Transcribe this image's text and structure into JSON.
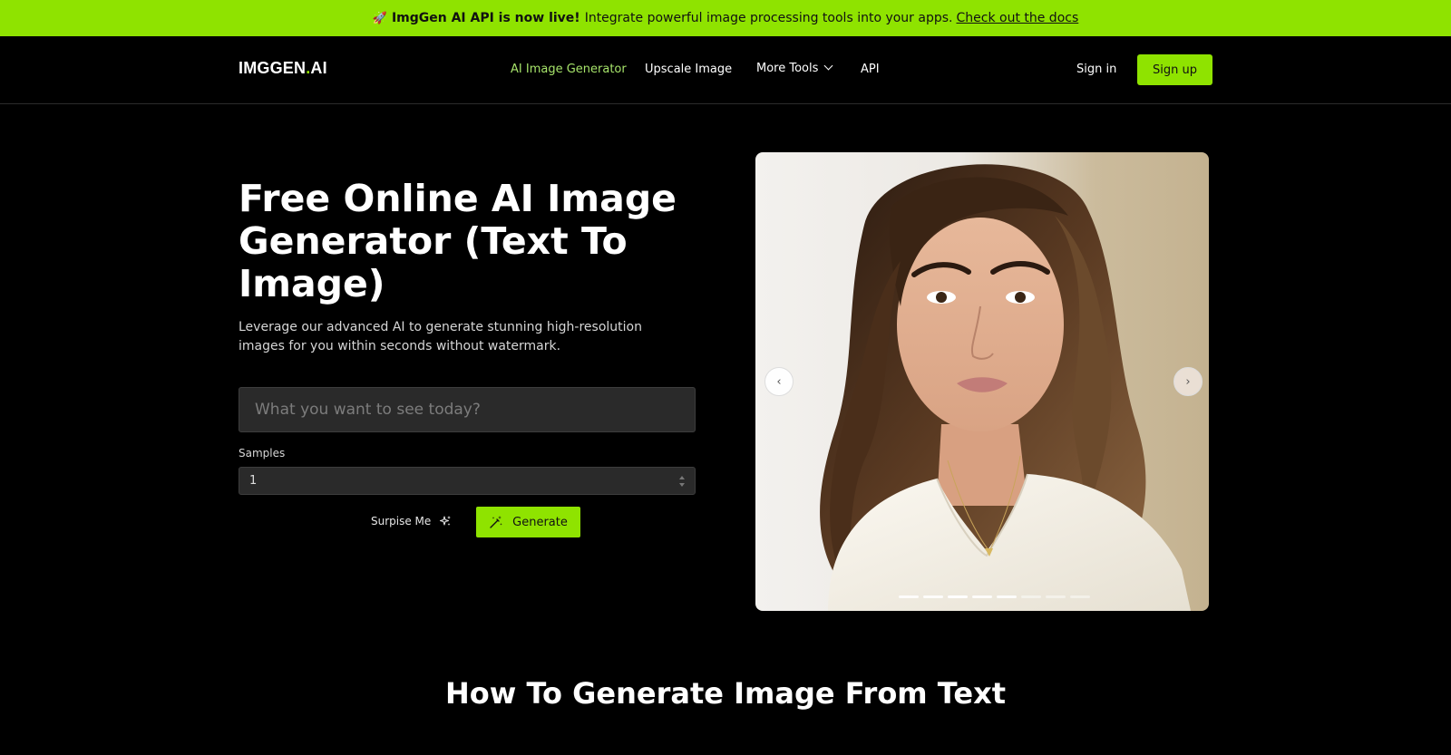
{
  "announcement": {
    "icon": "rocket-icon",
    "bold": "ImgGen AI API is now live!",
    "text": "Integrate powerful image processing tools into your apps.",
    "link": "Check out the docs"
  },
  "header": {
    "logo_main": "IMGGEN",
    "logo_dot": ".",
    "logo_suffix": "AI",
    "nav": [
      "AI Image Generator",
      "Upscale Image",
      "More Tools",
      "API"
    ],
    "signin": "Sign in",
    "signup": "Sign up"
  },
  "hero": {
    "title": "Free Online AI Image Generator (Text To Image)",
    "subtitle": "Leverage our advanced AI to generate stunning high-resolution images for you within seconds without watermark.",
    "prompt_placeholder": "What you want to see today?",
    "samples_label": "Samples",
    "samples_value": "1",
    "surprise_label": "Surpise Me",
    "generate_label": "Generate"
  },
  "carousel": {
    "prev": "‹",
    "next": "›",
    "active_index": 2,
    "slides": 8
  },
  "section": {
    "title": "How To Generate Image From Text"
  },
  "colors": {
    "accent": "#8fe300",
    "nav_active": "#a6e36a",
    "background": "#000000",
    "input_bg": "#2a2a2a"
  }
}
